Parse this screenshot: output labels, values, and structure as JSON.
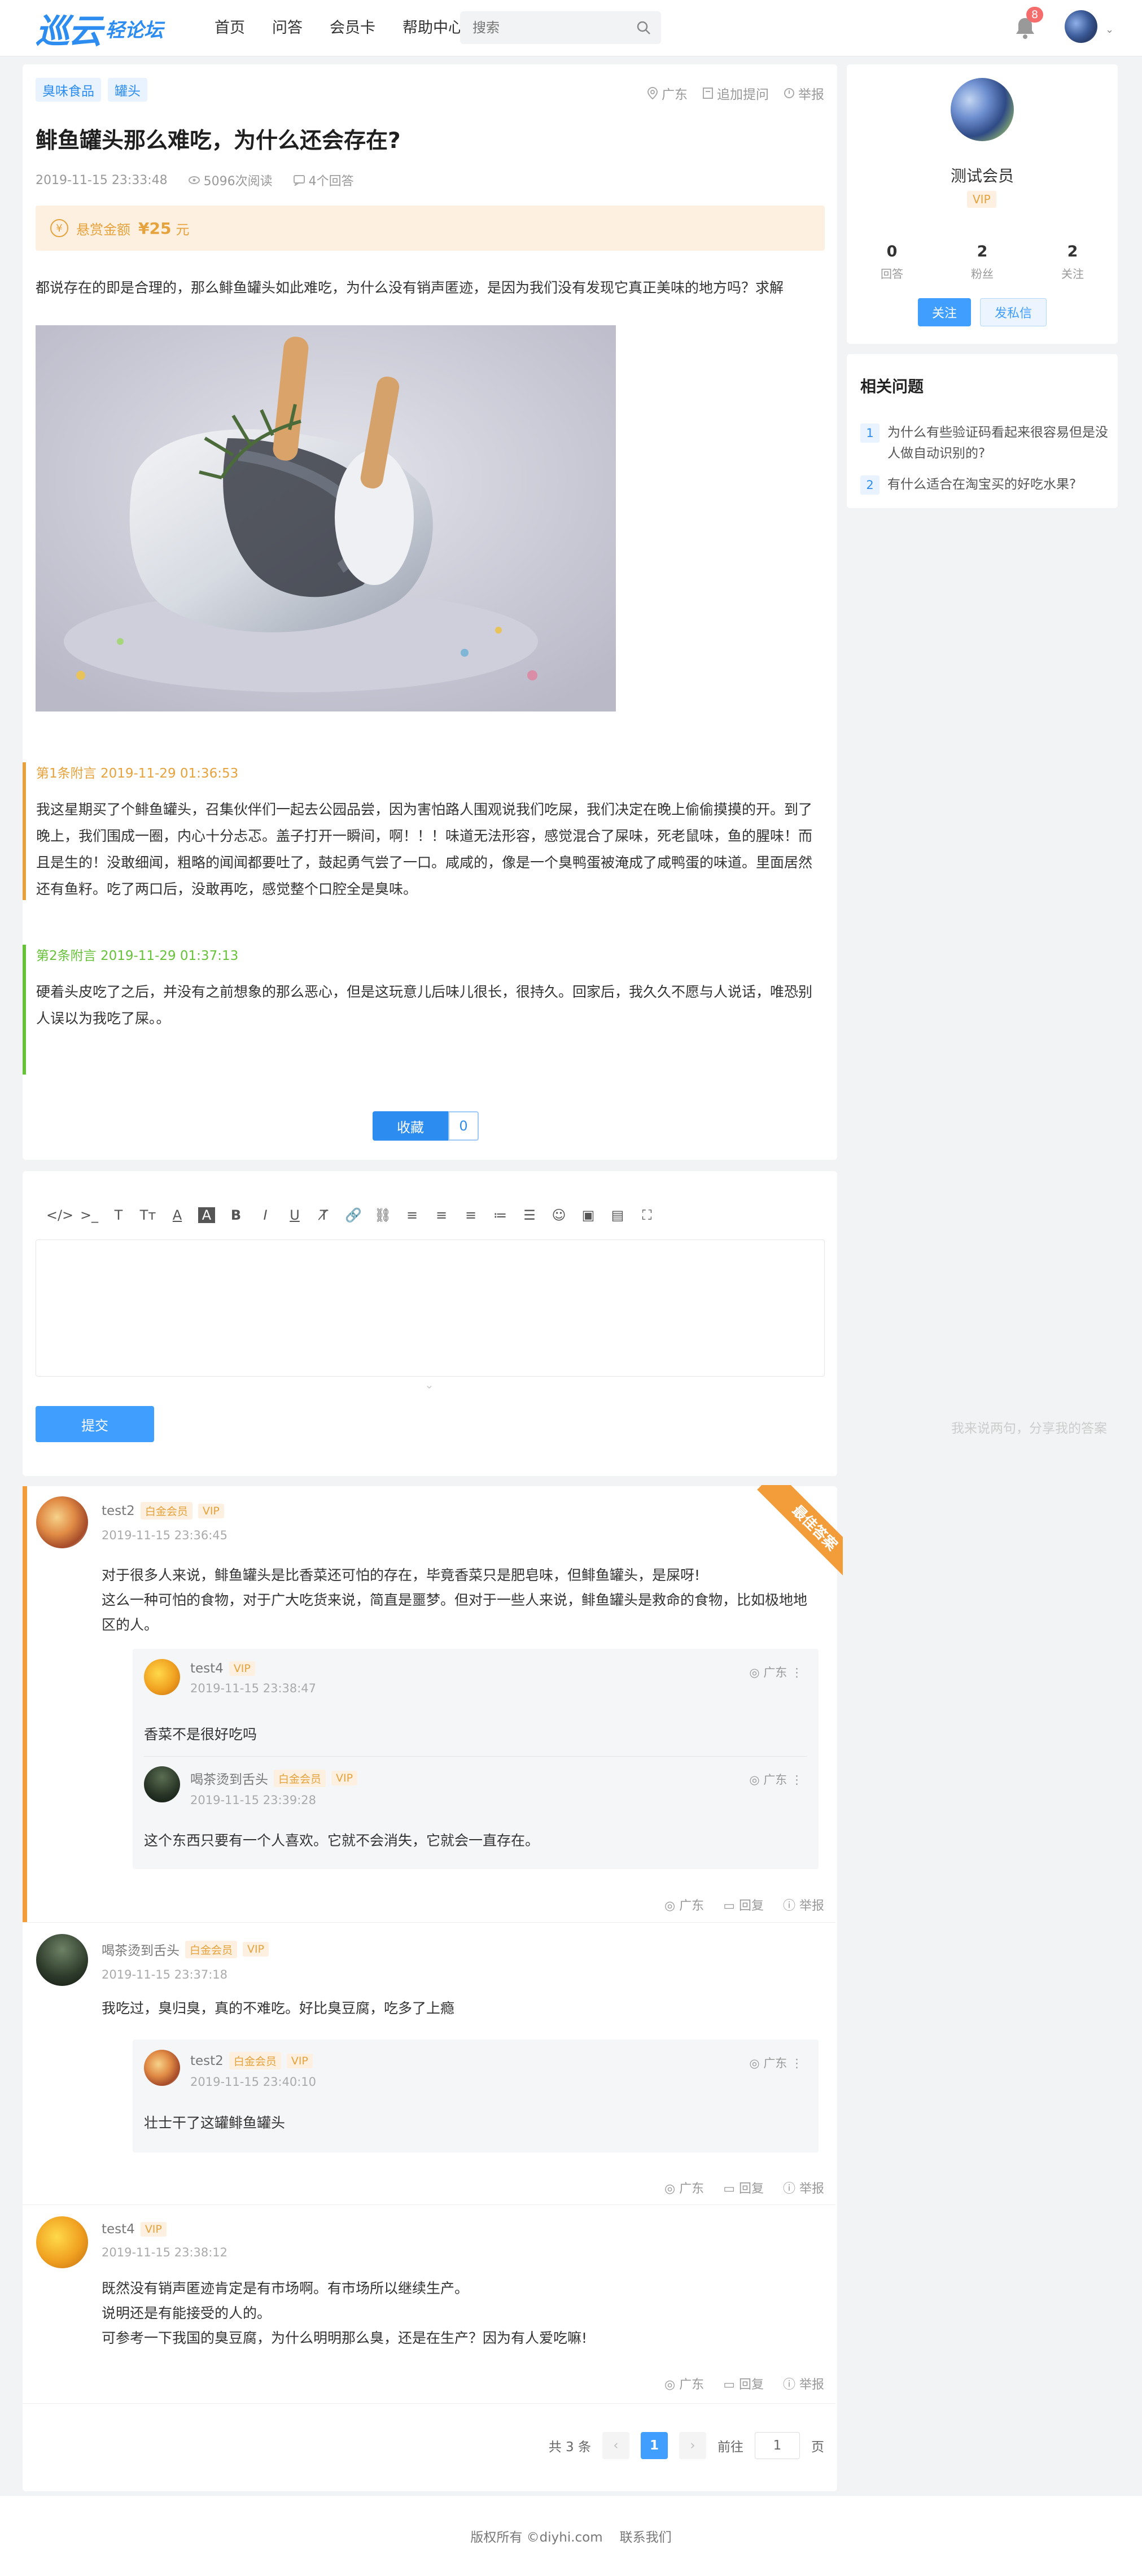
{
  "header": {
    "logo_main": "巡云",
    "logo_sub": "轻论坛",
    "nav": [
      "首页",
      "问答",
      "会员卡",
      "帮助中心"
    ],
    "search_placeholder": "搜索",
    "notify_count": "8"
  },
  "question": {
    "tags": [
      "臭味食品",
      "罐头"
    ],
    "location": "广东",
    "append_action": "追加提问",
    "report_action": "举报",
    "title": "鲱鱼罐头那么难吃，为什么还会存在?",
    "time": "2019-11-15 23:33:48",
    "views": "5096次阅读",
    "answers": "4个回答",
    "reward_label": "悬赏金额",
    "reward_amount": "¥25",
    "reward_unit": "元",
    "body": "都说存在的即是合理的，那么鲱鱼罐头如此难吃，为什么没有销声匿迹，是因为我们没有发现它真正美味的地方吗？求解"
  },
  "appends": [
    {
      "header": "第1条附言 2019-11-29 01:36:53",
      "body": "我这星期买了个鲱鱼罐头，召集伙伴们一起去公园品尝，因为害怕路人围观说我们吃屎，我们决定在晚上偷偷摸摸的开。到了晚上，我们围成一圈，内心十分忐忑。盖子打开一瞬间，啊！！！味道无法形容，感觉混合了屎味，死老鼠味，鱼的腥味！而且是生的！没敢细闻，粗略的闻闻都要吐了，鼓起勇气尝了一口。咸咸的，像是一个臭鸭蛋被淹成了咸鸭蛋的味道。里面居然还有鱼籽。吃了两口后，没敢再吃，感觉整个口腔全是臭味。"
    },
    {
      "header": "第2条附言 2019-11-29 01:37:13",
      "body": "硬着头皮吃了之后，并没有之前想象的那么恶心，但是这玩意儿后味儿很长，很持久。回家后，我久久不愿与人说话，唯恐别人误以为我吃了屎。。"
    }
  ],
  "collect": {
    "label": "收藏",
    "count": "0"
  },
  "editor": {
    "toolbar": [
      "</>",
      ">_",
      "T",
      "Tт",
      "A",
      "A",
      "B",
      "I",
      "U",
      "T̸",
      "🔗",
      "⛓",
      "≡",
      "≡",
      "≡",
      "≔",
      "☰",
      "☺",
      "▣",
      "▤",
      "⛶"
    ],
    "submit_label": "提交",
    "hint": "我来说两句，分享我的答案"
  },
  "best_answer_label": "最佳答案",
  "answers": [
    {
      "user": "test2",
      "level": "白金会员",
      "vip": "VIP",
      "time": "2019-11-15 23:36:45",
      "text": "对于很多人来说，鲱鱼罐头是比香菜还可怕的存在，毕竟香菜只是肥皂味，但鲱鱼罐头，是屎呀!\n这么一种可怕的食物，对于广大吃货来说，简直是噩梦。但对于一些人来说，鲱鱼罐头是救命的食物，比如极地地区的人。",
      "replies": [
        {
          "user": "test4",
          "level": "",
          "vip": "VIP",
          "time": "2019-11-15 23:38:47",
          "loc": "广东",
          "text": "香菜不是很好吃吗"
        },
        {
          "user": "喝茶烫到舌头",
          "level": "白金会员",
          "vip": "VIP",
          "time": "2019-11-15 23:39:28",
          "loc": "广东",
          "text": "这个东西只要有一个人喜欢。它就不会消失，它就会一直存在。"
        }
      ],
      "acts": [
        "广东",
        "回复",
        "举报"
      ]
    },
    {
      "user": "喝茶烫到舌头",
      "level": "白金会员",
      "vip": "VIP",
      "time": "2019-11-15 23:37:18",
      "text": "我吃过，臭归臭，真的不难吃。好比臭豆腐，吃多了上瘾",
      "replies": [
        {
          "user": "test2",
          "level": "白金会员",
          "vip": "VIP",
          "time": "2019-11-15 23:40:10",
          "loc": "广东",
          "text": "壮士干了这罐鲱鱼罐头"
        }
      ],
      "acts": [
        "广东",
        "回复",
        "举报"
      ]
    },
    {
      "user": "test4",
      "level": "",
      "vip": "VIP",
      "time": "2019-11-15 23:38:12",
      "text": "既然没有销声匿迹肯定是有市场啊。有市场所以继续生产。\n说明还是有能接受的人的。\n可参考一下我国的臭豆腐，为什么明明那么臭，还是在生产？因为有人爱吃嘛!",
      "replies": [],
      "acts": [
        "广东",
        "回复",
        "举报"
      ]
    }
  ],
  "pager": {
    "total": "共 3 条",
    "prev": "‹",
    "current": "1",
    "next": "›",
    "goto": "前往",
    "page_input": "1",
    "page_unit": "页"
  },
  "sidebar": {
    "name": "测试会员",
    "vip": "VIP",
    "stats": [
      {
        "n": "0",
        "l": "回答"
      },
      {
        "n": "2",
        "l": "粉丝"
      },
      {
        "n": "2",
        "l": "关注"
      }
    ],
    "follow_label": "关注",
    "message_label": "发私信",
    "related_title": "相关问题",
    "related": [
      {
        "num": "1",
        "text": "为什么有些验证码看起来很容易但是没人做自动识别的?"
      },
      {
        "num": "2",
        "text": "有什么适合在淘宝买的好吃水果?"
      }
    ]
  },
  "footer": {
    "copyright": "版权所有 ©diyhi.com",
    "contact": "联系我们"
  }
}
